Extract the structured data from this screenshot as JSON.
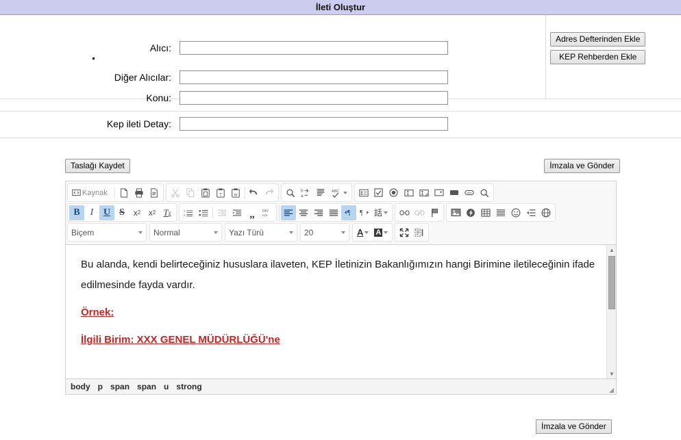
{
  "header": {
    "title": "İleti Oluştur",
    "bg": "#ccccee"
  },
  "form": {
    "fields": [
      {
        "label": "Alıcı:",
        "value": "",
        "placeholder": ""
      },
      {
        "label": "Diğer Alıcılar:",
        "value": "",
        "placeholder": ""
      },
      {
        "label": "Konu:",
        "value": "",
        "placeholder": ""
      }
    ],
    "side_buttons": [
      {
        "label": "Adres Defterinden Ekle"
      },
      {
        "label": "KEP Rehberden Ekle"
      }
    ]
  },
  "detail": {
    "label": "Kep ileti Detay:",
    "value": "",
    "placeholder": ""
  },
  "editor": {
    "save_draft_label": "Taslağı Kaydet",
    "send_top_label": "İmzala ve Gönder",
    "send_bottom_label": "İmzala ve Gönder",
    "toolbar": {
      "source_label": "Kaynak",
      "row1": [
        {
          "group": [
            {
              "name": "source-button",
              "icon": "source",
              "state": "normal",
              "label": "Kaynak"
            },
            {
              "name": "new-page-button",
              "icon": "new-page",
              "state": "normal"
            },
            {
              "name": "preview-button",
              "icon": "preview",
              "state": "normal"
            },
            {
              "name": "templates-button",
              "icon": "templates",
              "state": "normal"
            }
          ]
        },
        {
          "group": [
            {
              "name": "cut-button",
              "icon": "cut",
              "state": "disabled"
            },
            {
              "name": "copy-button",
              "icon": "copy",
              "state": "disabled"
            },
            {
              "name": "paste-button",
              "icon": "paste",
              "state": "normal"
            },
            {
              "name": "paste-text-button",
              "icon": "paste-text",
              "state": "normal"
            },
            {
              "name": "paste-word-button",
              "icon": "paste-word",
              "state": "normal"
            },
            {
              "name": "undo-button",
              "icon": "undo",
              "state": "normal"
            },
            {
              "name": "redo-button",
              "icon": "redo",
              "state": "disabled"
            }
          ]
        },
        {
          "group": [
            {
              "name": "find-button",
              "icon": "find",
              "state": "normal"
            },
            {
              "name": "replace-button",
              "icon": "replace",
              "state": "normal"
            },
            {
              "name": "select-all-button",
              "icon": "select-all",
              "state": "normal"
            },
            {
              "name": "spellcheck-button",
              "icon": "spellcheck",
              "state": "normal"
            }
          ]
        },
        {
          "group": [
            {
              "name": "form-button",
              "icon": "form",
              "state": "normal"
            },
            {
              "name": "checkbox-button",
              "icon": "checkbox",
              "state": "normal"
            },
            {
              "name": "radio-button",
              "icon": "radio",
              "state": "normal"
            },
            {
              "name": "text-field-button",
              "icon": "text-field",
              "state": "normal"
            },
            {
              "name": "textarea-button",
              "icon": "textarea",
              "state": "normal"
            },
            {
              "name": "select-field-button",
              "icon": "select-field",
              "state": "normal"
            },
            {
              "name": "button-field-button",
              "icon": "button-field",
              "state": "normal"
            },
            {
              "name": "image-button-button",
              "icon": "image-button",
              "state": "normal"
            },
            {
              "name": "hidden-field-button",
              "icon": "hidden-field",
              "state": "normal"
            }
          ]
        }
      ],
      "row2": [
        {
          "group": [
            {
              "name": "bold-button",
              "icon": "bold",
              "state": "active",
              "glyph": "B"
            },
            {
              "name": "italic-button",
              "icon": "italic",
              "state": "normal",
              "glyph": "I"
            },
            {
              "name": "underline-button",
              "icon": "underline",
              "state": "active",
              "glyph": "U"
            },
            {
              "name": "strike-button",
              "icon": "strike",
              "state": "normal",
              "glyph": "S"
            },
            {
              "name": "subscript-button",
              "icon": "subscript",
              "state": "normal",
              "glyph": "x₂"
            },
            {
              "name": "superscript-button",
              "icon": "superscript",
              "state": "normal",
              "glyph": "x²"
            },
            {
              "name": "remove-format-button",
              "icon": "remove-format",
              "state": "normal",
              "glyph": "Tx"
            }
          ]
        },
        {
          "group": [
            {
              "name": "numbered-list-button",
              "icon": "numbered-list",
              "state": "normal"
            },
            {
              "name": "bulleted-list-button",
              "icon": "bulleted-list",
              "state": "normal"
            },
            {
              "name": "outdent-button",
              "icon": "outdent",
              "state": "disabled"
            },
            {
              "name": "indent-button",
              "icon": "indent",
              "state": "normal"
            },
            {
              "name": "blockquote-button",
              "icon": "blockquote",
              "state": "normal"
            },
            {
              "name": "create-div-button",
              "icon": "create-div",
              "state": "normal"
            }
          ]
        },
        {
          "group": [
            {
              "name": "align-left-button",
              "icon": "align-left",
              "state": "active"
            },
            {
              "name": "align-center-button",
              "icon": "align-center",
              "state": "normal"
            },
            {
              "name": "align-right-button",
              "icon": "align-right",
              "state": "normal"
            },
            {
              "name": "align-justify-button",
              "icon": "align-justify",
              "state": "normal"
            },
            {
              "name": "ltr-button",
              "icon": "direction-ltr",
              "state": "active"
            },
            {
              "name": "rtl-button",
              "icon": "direction-rtl",
              "state": "normal"
            },
            {
              "name": "language-button",
              "icon": "language",
              "state": "normal",
              "glyph": "話"
            }
          ]
        },
        {
          "group": [
            {
              "name": "link-button",
              "icon": "link",
              "state": "normal"
            },
            {
              "name": "unlink-button",
              "icon": "unlink",
              "state": "disabled"
            },
            {
              "name": "anchor-button",
              "icon": "anchor-flag",
              "state": "normal"
            }
          ]
        },
        {
          "group": [
            {
              "name": "image-button",
              "icon": "image",
              "state": "normal"
            },
            {
              "name": "flash-button",
              "icon": "flash",
              "state": "normal"
            },
            {
              "name": "table-button",
              "icon": "table",
              "state": "normal"
            },
            {
              "name": "horizontal-rule-button",
              "icon": "horizontal-rule",
              "state": "normal"
            },
            {
              "name": "smiley-button",
              "icon": "smiley",
              "state": "normal"
            },
            {
              "name": "special-char-button",
              "icon": "special-char",
              "state": "normal"
            },
            {
              "name": "iframe-button",
              "icon": "iframe-globe",
              "state": "normal"
            }
          ]
        }
      ],
      "row3": {
        "combos": [
          {
            "name": "styles-combo",
            "label": "Biçem"
          },
          {
            "name": "format-combo",
            "label": "Normal"
          },
          {
            "name": "font-combo",
            "label": "Yazı Türü"
          },
          {
            "name": "fontsize-combo",
            "label": "20"
          }
        ],
        "color_buttons": [
          {
            "name": "text-color-button",
            "icon": "text-color",
            "glyph": "A"
          },
          {
            "name": "background-color-button",
            "icon": "bg-color",
            "glyph": "A"
          }
        ],
        "tool_buttons": [
          {
            "name": "maximize-button",
            "icon": "maximize"
          },
          {
            "name": "show-blocks-button",
            "icon": "show-blocks"
          }
        ]
      }
    },
    "content": {
      "paragraph": "Bu alanda, kendi belirteceğiniz hususlara ilaveten, KEP İletinizin Bakanlığımızın hangi Birimine iletileceğinin ifade edilmesinde fayda vardır.",
      "example_label": "Örnek:",
      "example_line": "İlgili Birim: XXX GENEL MÜDÜRLÜĞÜ'ne",
      "text_color": "#d52020"
    },
    "element_path": [
      "body",
      "p",
      "span",
      "span",
      "u",
      "strong"
    ]
  }
}
